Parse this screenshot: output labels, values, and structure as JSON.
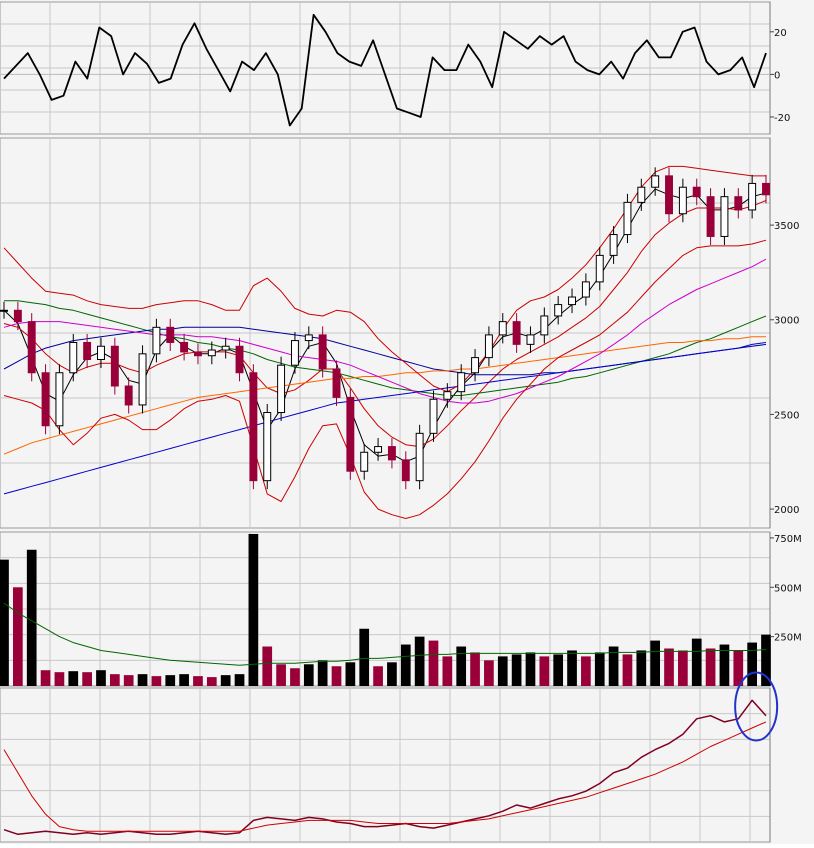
{
  "chart_data": [
    {
      "panel": "oscillator",
      "type": "line",
      "y_tick_labels": [
        "20",
        "0",
        "-20"
      ],
      "y_ticks": [
        20,
        0,
        -20
      ],
      "ylim": [
        -28,
        34
      ],
      "grid": true,
      "series": [
        {
          "color": "#000000",
          "values": [
            -2,
            4,
            10,
            0,
            -12,
            -10,
            6,
            -2,
            22,
            18,
            0,
            10,
            5,
            -4,
            -2,
            14,
            24,
            12,
            2,
            -8,
            6,
            2,
            10,
            0,
            -24,
            -16,
            28,
            20,
            10,
            6,
            4,
            16,
            0,
            -16,
            -18,
            -20,
            8,
            2,
            2,
            14,
            6,
            -6,
            20,
            16,
            12,
            18,
            14,
            18,
            6,
            2,
            0,
            6,
            -2,
            10,
            16,
            8,
            8,
            20,
            22,
            6,
            0,
            2,
            8,
            -6,
            10
          ]
        }
      ]
    },
    {
      "panel": "price",
      "type": "candlestick",
      "y_tick_labels": [
        "3500",
        "3000",
        "2500",
        "2000"
      ],
      "y_ticks": [
        3500,
        3000,
        2500,
        2000
      ],
      "ylim": [
        1900,
        3960
      ],
      "grid": true,
      "close": [
        3050,
        2990,
        2720,
        2440,
        2720,
        2880,
        2790,
        2860,
        2650,
        2550,
        2820,
        2960,
        2880,
        2830,
        2810,
        2840,
        2860,
        2720,
        2150,
        2510,
        2760,
        2890,
        2920,
        2740,
        2590,
        2200,
        2300,
        2330,
        2260,
        2150,
        2400,
        2580,
        2620,
        2720,
        2800,
        2920,
        2990,
        2870,
        2920,
        3020,
        3080,
        3120,
        3200,
        3340,
        3450,
        3620,
        3700,
        3760,
        3560,
        3700,
        3650,
        3440,
        3650,
        3580,
        3720,
        3660
      ],
      "series": [
        {
          "color": "#000000",
          "values": [
            3050,
            2980,
            2800,
            2610,
            2570,
            2710,
            2800,
            2830,
            2790,
            2680,
            2660,
            2840,
            2920,
            2860,
            2820,
            2820,
            2850,
            2820,
            2620,
            2420,
            2530,
            2740,
            2860,
            2880,
            2770,
            2530,
            2340,
            2280,
            2290,
            2250,
            2280,
            2430,
            2560,
            2650,
            2720,
            2830,
            2910,
            2930,
            2910,
            2950,
            3020,
            3080,
            3130,
            3230,
            3350,
            3480,
            3610,
            3690,
            3660,
            3640,
            3660,
            3580,
            3580,
            3600,
            3650,
            3670
          ]
        },
        {
          "color": "#cc0000",
          "values": [
            2980,
            2960,
            2900,
            2820,
            2760,
            2720,
            2750,
            2770,
            2770,
            2740,
            2720,
            2760,
            2790,
            2820,
            2830,
            2830,
            2830,
            2810,
            2720,
            2640,
            2610,
            2630,
            2680,
            2740,
            2740,
            2640,
            2530,
            2440,
            2380,
            2340,
            2330,
            2370,
            2440,
            2520,
            2590,
            2670,
            2740,
            2790,
            2830,
            2870,
            2910,
            2960,
            3010,
            3070,
            3160,
            3250,
            3360,
            3450,
            3510,
            3560,
            3590,
            3590,
            3590,
            3580,
            3600,
            3630
          ]
        },
        {
          "color": "#006600",
          "values": [
            3100,
            3100,
            3090,
            3080,
            3060,
            3050,
            3030,
            3010,
            2990,
            2970,
            2950,
            2930,
            2910,
            2900,
            2880,
            2870,
            2850,
            2840,
            2820,
            2790,
            2770,
            2750,
            2740,
            2730,
            2720,
            2700,
            2680,
            2660,
            2640,
            2630,
            2620,
            2610,
            2600,
            2600,
            2610,
            2620,
            2630,
            2640,
            2650,
            2660,
            2670,
            2690,
            2700,
            2720,
            2740,
            2760,
            2780,
            2800,
            2820,
            2850,
            2880,
            2900,
            2930,
            2960,
            2990,
            3020
          ]
        },
        {
          "color": "#000099",
          "values": [
            2740,
            2780,
            2820,
            2850,
            2870,
            2890,
            2900,
            2910,
            2920,
            2930,
            2940,
            2950,
            2950,
            2960,
            2960,
            2960,
            2960,
            2960,
            2950,
            2940,
            2930,
            2920,
            2910,
            2900,
            2880,
            2860,
            2840,
            2820,
            2800,
            2780,
            2760,
            2740,
            2730,
            2720,
            2710,
            2710,
            2710,
            2710,
            2710,
            2720,
            2720,
            2730,
            2740,
            2750,
            2760,
            2770,
            2780,
            2790,
            2800,
            2810,
            2820,
            2830,
            2840,
            2850,
            2860,
            2870
          ]
        },
        {
          "color": "#ff6600",
          "values": [
            2290,
            2320,
            2350,
            2370,
            2390,
            2410,
            2430,
            2450,
            2470,
            2490,
            2510,
            2530,
            2550,
            2570,
            2590,
            2600,
            2610,
            2620,
            2630,
            2640,
            2650,
            2660,
            2670,
            2680,
            2690,
            2690,
            2700,
            2700,
            2710,
            2720,
            2720,
            2730,
            2730,
            2740,
            2740,
            2750,
            2760,
            2770,
            2780,
            2790,
            2800,
            2810,
            2820,
            2830,
            2840,
            2850,
            2860,
            2870,
            2880,
            2880,
            2890,
            2890,
            2900,
            2900,
            2910,
            2910
          ]
        },
        {
          "color": "#0000cc",
          "values": [
            2080,
            2100,
            2120,
            2140,
            2160,
            2180,
            2200,
            2220,
            2240,
            2260,
            2280,
            2300,
            2320,
            2340,
            2360,
            2380,
            2400,
            2420,
            2440,
            2460,
            2480,
            2500,
            2520,
            2540,
            2560,
            2570,
            2580,
            2590,
            2600,
            2610,
            2620,
            2630,
            2640,
            2650,
            2660,
            2670,
            2680,
            2690,
            2700,
            2710,
            2720,
            2730,
            2740,
            2750,
            2760,
            2770,
            2780,
            2790,
            2800,
            2810,
            2820,
            2830,
            2840,
            2850,
            2870,
            2880
          ]
        },
        {
          "color": "#cc00cc",
          "values": [
            2960,
            2980,
            2990,
            2990,
            2990,
            2980,
            2970,
            2960,
            2950,
            2940,
            2930,
            2920,
            2920,
            2920,
            2910,
            2910,
            2900,
            2890,
            2870,
            2850,
            2830,
            2810,
            2800,
            2790,
            2780,
            2760,
            2730,
            2700,
            2670,
            2640,
            2610,
            2590,
            2570,
            2560,
            2560,
            2570,
            2590,
            2610,
            2640,
            2670,
            2700,
            2740,
            2780,
            2820,
            2870,
            2920,
            2980,
            3030,
            3080,
            3120,
            3160,
            3190,
            3220,
            3250,
            3280,
            3320
          ]
        },
        {
          "color": "#cc0000",
          "values": [
            3380,
            3300,
            3220,
            3150,
            3140,
            3130,
            3100,
            3080,
            3070,
            3060,
            3060,
            3080,
            3090,
            3100,
            3100,
            3080,
            3050,
            3050,
            3180,
            3220,
            3150,
            3060,
            3030,
            3020,
            3050,
            3040,
            2990,
            2900,
            2830,
            2770,
            2710,
            2650,
            2620,
            2660,
            2740,
            2830,
            2950,
            3050,
            3100,
            3120,
            3160,
            3220,
            3290,
            3380,
            3480,
            3590,
            3700,
            3780,
            3810,
            3810,
            3800,
            3790,
            3780,
            3770,
            3760,
            3760
          ]
        },
        {
          "color": "#cc0000",
          "values": [
            2600,
            2580,
            2560,
            2520,
            2420,
            2340,
            2400,
            2480,
            2500,
            2470,
            2420,
            2420,
            2470,
            2530,
            2570,
            2580,
            2600,
            2570,
            2330,
            2080,
            2040,
            2170,
            2320,
            2440,
            2450,
            2280,
            2090,
            2000,
            1970,
            1950,
            1970,
            2020,
            2080,
            2160,
            2250,
            2360,
            2480,
            2580,
            2660,
            2740,
            2800,
            2840,
            2880,
            2920,
            2980,
            3040,
            3120,
            3200,
            3270,
            3340,
            3380,
            3390,
            3390,
            3390,
            3400,
            3420
          ]
        }
      ]
    },
    {
      "panel": "volume",
      "type": "bar",
      "y_tick_labels": [
        "750M",
        "500M",
        "250M"
      ],
      "y_ticks": [
        750,
        500,
        250
      ],
      "ylim": [
        0,
        780
      ],
      "grid": true,
      "values": [
        640,
        500,
        690,
        80,
        70,
        75,
        70,
        80,
        60,
        55,
        60,
        50,
        55,
        60,
        50,
        45,
        55,
        60,
        770,
        200,
        110,
        90,
        110,
        130,
        100,
        120,
        290,
        100,
        120,
        210,
        250,
        230,
        150,
        200,
        170,
        130,
        150,
        160,
        170,
        150,
        160,
        180,
        150,
        170,
        200,
        160,
        180,
        230,
        190,
        180,
        240,
        190,
        210,
        180,
        220,
        260
      ],
      "series": [
        {
          "color": "#006600",
          "values": [
            420,
            370,
            330,
            290,
            250,
            220,
            200,
            180,
            170,
            160,
            150,
            140,
            130,
            125,
            120,
            115,
            110,
            105,
            110,
            115,
            115,
            115,
            120,
            125,
            125,
            130,
            140,
            140,
            145,
            150,
            155,
            160,
            160,
            165,
            165,
            165,
            165,
            165,
            165,
            165,
            165,
            165,
            165,
            165,
            170,
            170,
            170,
            175,
            175,
            175,
            175,
            180,
            180,
            180,
            180,
            185
          ]
        }
      ]
    },
    {
      "panel": "indicator",
      "type": "line",
      "ylim": [
        0,
        100
      ],
      "grid": true,
      "series": [
        {
          "color": "#800020",
          "values": [
            8,
            5,
            6,
            7,
            6,
            5,
            6,
            5,
            6,
            7,
            6,
            5,
            5,
            6,
            7,
            6,
            5,
            6,
            14,
            16,
            15,
            14,
            16,
            15,
            13,
            12,
            10,
            10,
            11,
            12,
            10,
            9,
            11,
            13,
            15,
            17,
            20,
            24,
            22,
            25,
            28,
            30,
            33,
            38,
            45,
            48,
            55,
            60,
            64,
            70,
            80,
            82,
            78,
            80,
            92,
            82
          ]
        },
        {
          "color": "#cc0000",
          "values": [
            60,
            45,
            30,
            18,
            10,
            8,
            7,
            7,
            7,
            7,
            7,
            7,
            7,
            7,
            7,
            7,
            7,
            7,
            9,
            11,
            12,
            13,
            14,
            14,
            14,
            14,
            13,
            12,
            12,
            12,
            12,
            12,
            12,
            13,
            14,
            15,
            17,
            19,
            21,
            23,
            25,
            27,
            29,
            32,
            35,
            38,
            41,
            44,
            48,
            52,
            57,
            62,
            66,
            70,
            74,
            78
          ]
        }
      ],
      "annotations": [
        {
          "type": "circle",
          "color": "#2233cc"
        }
      ]
    }
  ]
}
